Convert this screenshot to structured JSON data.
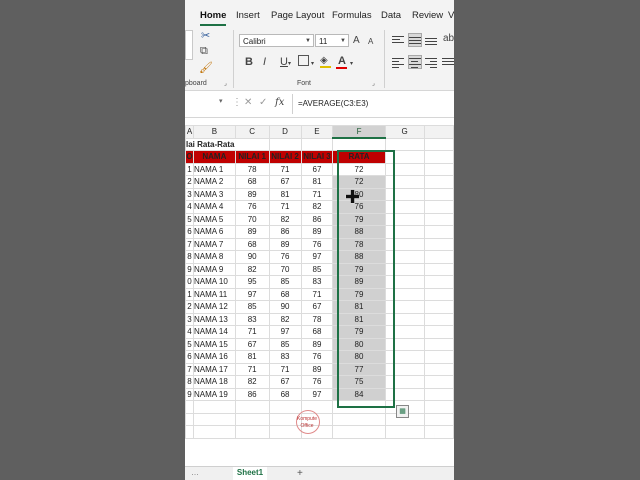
{
  "ribbon": {
    "tabs": [
      "Home",
      "Insert",
      "Page Layout",
      "Formulas",
      "Data",
      "Review",
      "V"
    ],
    "active_tab": "Home",
    "clipboard_label": "pboard",
    "font_group_label": "Font",
    "font_name": "Calibri",
    "font_size": "11",
    "bold": "B",
    "italic": "I",
    "underline": "U",
    "font_color_letter": "A",
    "grow_font": "A",
    "shrink_font": "A"
  },
  "formula_bar": {
    "fx": "fx",
    "formula": "=AVERAGE(C3:E3)"
  },
  "columns": [
    "A",
    "B",
    "C",
    "D",
    "E",
    "F",
    "G"
  ],
  "selected_column": "F",
  "sheet_title": "lai Rata-Rata",
  "table_headers": [
    "O",
    "NAMA",
    "NILAI 1",
    "NILAI 2",
    "NILAI 3",
    "RATA"
  ],
  "rows": [
    {
      "no": "1",
      "nama": "NAMA 1",
      "n1": "78",
      "n2": "71",
      "n3": "67",
      "rata": "72"
    },
    {
      "no": "2",
      "nama": "NAMA 2",
      "n1": "68",
      "n2": "67",
      "n3": "81",
      "rata": "72"
    },
    {
      "no": "3",
      "nama": "NAMA 3",
      "n1": "89",
      "n2": "81",
      "n3": "71",
      "rata": "80"
    },
    {
      "no": "4",
      "nama": "NAMA 4",
      "n1": "76",
      "n2": "71",
      "n3": "82",
      "rata": "76"
    },
    {
      "no": "5",
      "nama": "NAMA 5",
      "n1": "70",
      "n2": "82",
      "n3": "86",
      "rata": "79"
    },
    {
      "no": "6",
      "nama": "NAMA 6",
      "n1": "89",
      "n2": "86",
      "n3": "89",
      "rata": "88"
    },
    {
      "no": "7",
      "nama": "NAMA 7",
      "n1": "68",
      "n2": "89",
      "n3": "76",
      "rata": "78"
    },
    {
      "no": "8",
      "nama": "NAMA 8",
      "n1": "90",
      "n2": "76",
      "n3": "97",
      "rata": "88"
    },
    {
      "no": "9",
      "nama": "NAMA 9",
      "n1": "82",
      "n2": "70",
      "n3": "85",
      "rata": "79"
    },
    {
      "no": "0",
      "nama": "NAMA 10",
      "n1": "95",
      "n2": "85",
      "n3": "83",
      "rata": "89"
    },
    {
      "no": "1",
      "nama": "NAMA 11",
      "n1": "97",
      "n2": "68",
      "n3": "71",
      "rata": "79"
    },
    {
      "no": "2",
      "nama": "NAMA 12",
      "n1": "85",
      "n2": "90",
      "n3": "67",
      "rata": "81"
    },
    {
      "no": "3",
      "nama": "NAMA 13",
      "n1": "83",
      "n2": "82",
      "n3": "78",
      "rata": "81"
    },
    {
      "no": "4",
      "nama": "NAMA 14",
      "n1": "71",
      "n2": "97",
      "n3": "68",
      "rata": "79"
    },
    {
      "no": "5",
      "nama": "NAMA 15",
      "n1": "67",
      "n2": "85",
      "n3": "89",
      "rata": "80"
    },
    {
      "no": "6",
      "nama": "NAMA 16",
      "n1": "81",
      "n2": "83",
      "n3": "76",
      "rata": "80"
    },
    {
      "no": "7",
      "nama": "NAMA 17",
      "n1": "71",
      "n2": "71",
      "n3": "89",
      "rata": "77"
    },
    {
      "no": "8",
      "nama": "NAMA 18",
      "n1": "82",
      "n2": "67",
      "n3": "76",
      "rata": "75"
    },
    {
      "no": "9",
      "nama": "NAMA 19",
      "n1": "86",
      "n2": "68",
      "n3": "97",
      "rata": "84"
    }
  ],
  "watermark": {
    "line1": "Kompute",
    "line2": "Office"
  },
  "sheet_tab": "Sheet1",
  "add_sheet": "+",
  "colors": {
    "accent": "#1e7145",
    "header_red": "#c00000",
    "selection_fill": "#d0d0d0"
  }
}
